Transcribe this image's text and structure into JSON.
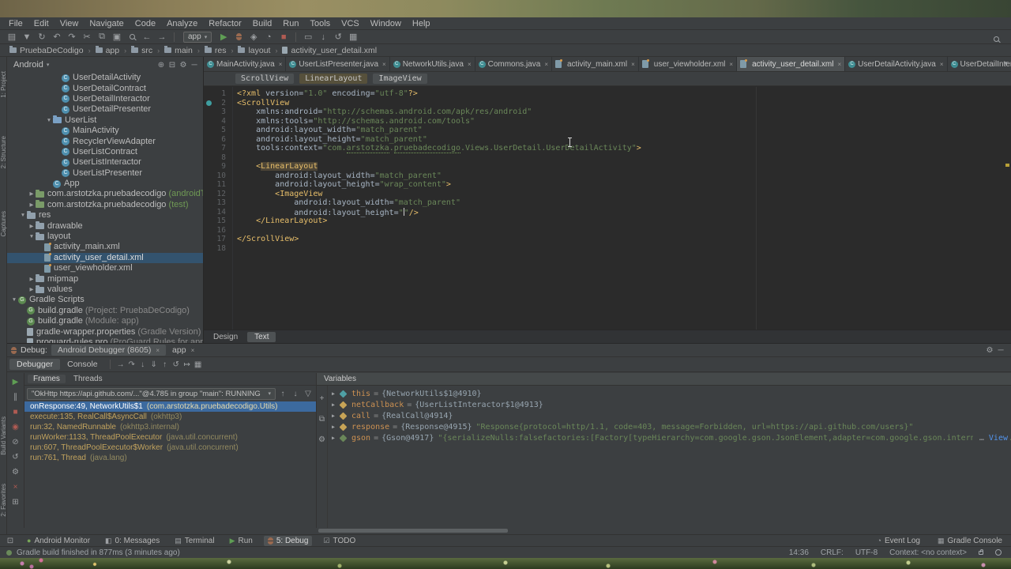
{
  "menubar": {
    "items": [
      "File",
      "Edit",
      "View",
      "Navigate",
      "Code",
      "Analyze",
      "Refactor",
      "Build",
      "Run",
      "Tools",
      "VCS",
      "Window",
      "Help"
    ]
  },
  "toolbar": {
    "icons_a": [
      {
        "name": "open-icon",
        "glyph": "▤"
      },
      {
        "name": "save-all-icon",
        "glyph": "▼"
      },
      {
        "name": "sync-icon",
        "glyph": "↻"
      },
      {
        "name": "undo-icon",
        "glyph": "↶"
      },
      {
        "name": "redo-icon",
        "glyph": "↷"
      },
      {
        "name": "cut-icon",
        "glyph": "✂"
      },
      {
        "name": "copy-icon",
        "glyph": "⧉"
      },
      {
        "name": "paste-icon",
        "glyph": "▣"
      },
      {
        "name": "find-icon",
        "shape": "magnifier"
      },
      {
        "name": "back-icon",
        "glyph": "←"
      },
      {
        "name": "forward-icon",
        "glyph": "→"
      }
    ],
    "run_config": "app",
    "icons_b": [
      {
        "name": "run-icon",
        "glyph": "▶",
        "color": "#5f9e54"
      },
      {
        "name": "debug-icon",
        "shape": "bug"
      },
      {
        "name": "coverage-icon",
        "glyph": "◈"
      },
      {
        "name": "profiler-icon",
        "glyph": "◔"
      },
      {
        "name": "stop-icon",
        "glyph": "■",
        "color": "#b05b53"
      }
    ],
    "icons_c": [
      {
        "name": "avd-manager-icon",
        "glyph": "▭"
      },
      {
        "name": "sdk-manager-icon",
        "glyph": "↓"
      },
      {
        "name": "gradle-sync-icon",
        "glyph": "↺"
      },
      {
        "name": "project-structure-icon",
        "glyph": "▦"
      }
    ]
  },
  "navbar": {
    "items": [
      "PruebaDeCodigo",
      "app",
      "src",
      "main",
      "res",
      "layout",
      "activity_user_detail.xml"
    ]
  },
  "stripe": {
    "top": [
      "1: Project",
      "2: Structure",
      "Captures"
    ],
    "bottom": [
      "Build Variants",
      "2: Favorites"
    ]
  },
  "project": {
    "mode": "Android",
    "rows": [
      {
        "label": "UserDetailActivity",
        "icon": "class",
        "lvl": 5
      },
      {
        "label": "UserDetailContract",
        "icon": "class",
        "lvl": 5
      },
      {
        "label": "UserDetailInteractor",
        "icon": "class",
        "lvl": 5
      },
      {
        "label": "UserDetailPresenter",
        "icon": "class",
        "lvl": 5
      },
      {
        "label": "UserList",
        "icon": "folder",
        "color": "#7aa0c4",
        "arrow": "down",
        "lvl": 4
      },
      {
        "label": "MainActivity",
        "icon": "class",
        "lvl": 5
      },
      {
        "label": "RecyclerViewAdapter",
        "icon": "class",
        "lvl": 5
      },
      {
        "label": "UserListContract",
        "icon": "class",
        "lvl": 5
      },
      {
        "label": "UserListInteractor",
        "icon": "class",
        "lvl": 5
      },
      {
        "label": "UserListPresenter",
        "icon": "class",
        "lvl": 5
      },
      {
        "label": "App",
        "icon": "class",
        "lvl": 4
      },
      {
        "label": "com.arstotzka.pruebadecodigo",
        "suffix": " (androidTest)",
        "green": true,
        "icon": "folder",
        "color": "#7a9b68",
        "arrow": "right",
        "lvl": 2
      },
      {
        "label": "com.arstotzka.pruebadecodigo",
        "suffix": " (test)",
        "green": true,
        "icon": "folder",
        "color": "#7a9b68",
        "arrow": "right",
        "lvl": 2
      },
      {
        "label": "res",
        "icon": "folder",
        "arrow": "down",
        "lvl": 1
      },
      {
        "label": "drawable",
        "icon": "folder",
        "arrow": "right",
        "lvl": 2
      },
      {
        "label": "layout",
        "icon": "folder",
        "arrow": "down",
        "lvl": 2
      },
      {
        "label": "activity_main.xml",
        "icon": "xml",
        "lvl": 3
      },
      {
        "label": "activity_user_detail.xml",
        "icon": "xml",
        "lvl": 3,
        "selected": true
      },
      {
        "label": "user_viewholder.xml",
        "icon": "xml",
        "lvl": 3
      },
      {
        "label": "mipmap",
        "icon": "folder",
        "arrow": "right",
        "lvl": 2
      },
      {
        "label": "values",
        "icon": "folder",
        "arrow": "right",
        "lvl": 2
      },
      {
        "label": "Gradle Scripts",
        "icon": "gradle",
        "arrow": "down",
        "lvl": 0
      },
      {
        "label": "build.gradle",
        "suffix": " (Project: PruebaDeCodigo)",
        "icon": "gradle",
        "lvl": 1
      },
      {
        "label": "build.gradle",
        "suffix": " (Module: app)",
        "icon": "gradle",
        "lvl": 1
      },
      {
        "label": "gradle-wrapper.properties",
        "suffix": " (Gradle Version)",
        "icon": "file",
        "lvl": 1
      },
      {
        "label": "proguard-rules.pro",
        "suffix": " (ProGuard Rules for app)",
        "icon": "file",
        "lvl": 1
      }
    ]
  },
  "editor": {
    "tabs": [
      {
        "label": "MainActivity.java",
        "icon": "java"
      },
      {
        "label": "UserListPresenter.java",
        "icon": "java"
      },
      {
        "label": "NetworkUtils.java",
        "icon": "java"
      },
      {
        "label": "Commons.java",
        "icon": "java"
      },
      {
        "label": "activity_main.xml",
        "icon": "xml"
      },
      {
        "label": "user_viewholder.xml",
        "icon": "xml"
      },
      {
        "label": "activity_user_detail.xml",
        "icon": "xml",
        "active": true
      },
      {
        "label": "UserDetailActivity.java",
        "icon": "java"
      },
      {
        "label": "UserDetailInteractor.java",
        "icon": "java"
      }
    ],
    "crumbs": [
      {
        "label": "ScrollView"
      },
      {
        "label": "LinearLayout",
        "hl": true
      },
      {
        "label": "ImageView"
      }
    ],
    "lines": [
      {
        "t": [
          [
            "pi",
            "<?xml "
          ],
          [
            "attr",
            "version="
          ],
          [
            "val",
            "\"1.0\""
          ],
          [
            "attr",
            " encoding="
          ],
          [
            "val",
            "\"utf-8\""
          ],
          [
            "pi",
            "?>"
          ]
        ]
      },
      {
        "g": true,
        "t": [
          [
            "tag",
            "<ScrollView"
          ]
        ]
      },
      {
        "t": [
          [
            "plain",
            "    "
          ],
          [
            "attr",
            "xmlns:android="
          ],
          [
            "val",
            "\"http://schemas.android.com/apk/res/android\""
          ]
        ]
      },
      {
        "t": [
          [
            "plain",
            "    "
          ],
          [
            "attr",
            "xmlns:tools="
          ],
          [
            "val",
            "\"http://schemas.android.com/tools\""
          ]
        ]
      },
      {
        "t": [
          [
            "plain",
            "    "
          ],
          [
            "attr",
            "android:layout_width="
          ],
          [
            "val",
            "\"match_parent\""
          ]
        ]
      },
      {
        "t": [
          [
            "plain",
            "    "
          ],
          [
            "attr",
            "android:layout_height="
          ],
          [
            "val",
            "\"match_parent\""
          ]
        ]
      },
      {
        "t": [
          [
            "plain",
            "    "
          ],
          [
            "attr",
            "tools:context="
          ],
          [
            "val",
            "\"com."
          ],
          [
            "valu",
            "arstotzka"
          ],
          [
            "val",
            "."
          ],
          [
            "valu",
            "pruebadecodigo"
          ],
          [
            "val",
            ".Views.UserDetail.UserDetailActivity\""
          ],
          [
            "tag",
            ">"
          ]
        ]
      },
      {
        "t": []
      },
      {
        "t": [
          [
            "plain",
            "    "
          ],
          [
            "tag",
            "<"
          ],
          [
            "taghl",
            "LinearLayout"
          ]
        ]
      },
      {
        "t": [
          [
            "plain",
            "        "
          ],
          [
            "attr",
            "android:layout_width="
          ],
          [
            "val",
            "\"match_parent\""
          ]
        ]
      },
      {
        "t": [
          [
            "plain",
            "        "
          ],
          [
            "attr",
            "android:layout_height="
          ],
          [
            "val",
            "\"wrap_content\""
          ],
          [
            "tag",
            ">"
          ]
        ]
      },
      {
        "t": [
          [
            "plain",
            "        "
          ],
          [
            "tag",
            "<ImageView"
          ]
        ]
      },
      {
        "t": [
          [
            "plain",
            "            "
          ],
          [
            "attr",
            "android:layout_width="
          ],
          [
            "val",
            "\"match_parent\""
          ]
        ]
      },
      {
        "t": [
          [
            "plain",
            "            "
          ],
          [
            "attr",
            "android:layout_height="
          ],
          [
            "val",
            "\""
          ],
          [
            "cursor",
            ""
          ],
          [
            "val",
            "\""
          ],
          [
            "tag",
            "/>"
          ]
        ]
      },
      {
        "t": [
          [
            "plain",
            "    "
          ],
          [
            "tag",
            "</LinearLayout>"
          ]
        ]
      },
      {
        "t": []
      },
      {
        "t": [
          [
            "tag",
            "</ScrollView>"
          ]
        ]
      },
      {
        "t": []
      }
    ],
    "bottom_tabs": [
      {
        "label": "Design"
      },
      {
        "label": "Text",
        "active": true
      }
    ]
  },
  "debug": {
    "title": "Debug:",
    "session_tabs": [
      {
        "label": "Android Debugger (8605)",
        "active": true
      },
      {
        "label": "app"
      }
    ],
    "view_tabs": [
      {
        "label": "Debugger",
        "active": true
      },
      {
        "label": "Console"
      }
    ],
    "step_icons": [
      {
        "name": "show-execution-point-icon",
        "glyph": "→"
      },
      {
        "name": "step-over-icon",
        "glyph": "↷"
      },
      {
        "name": "step-into-icon",
        "glyph": "↓"
      },
      {
        "name": "force-step-into-icon",
        "glyph": "⇓"
      },
      {
        "name": "step-out-icon",
        "glyph": "↑"
      },
      {
        "name": "drop-frame-icon",
        "glyph": "↺"
      },
      {
        "name": "run-to-cursor-icon",
        "glyph": "↦"
      },
      {
        "name": "evaluate-expression-icon",
        "glyph": "▦"
      }
    ],
    "left_icons": [
      {
        "name": "resume-icon",
        "glyph": "▶",
        "color": "#5f9e54"
      },
      {
        "name": "pause-icon",
        "glyph": "∥"
      },
      {
        "name": "stop-icon",
        "glyph": "■",
        "color": "#b05b53"
      },
      {
        "name": "view-breakpoints-icon",
        "glyph": "◉",
        "color": "#b05b53"
      },
      {
        "name": "mute-breakpoints-icon",
        "glyph": "⊘"
      },
      {
        "name": "restore-layout-icon",
        "glyph": "↺"
      },
      {
        "name": "debug-settings-icon",
        "glyph": "⚙"
      },
      {
        "name": "close-session-icon",
        "glyph": "×",
        "color": "#b05b53"
      },
      {
        "name": "pin-icon",
        "glyph": "⊞"
      }
    ],
    "frames_tabs": [
      {
        "label": "Frames",
        "active": true
      },
      {
        "label": "Threads"
      }
    ],
    "thread_combo": "\"OkHttp https://api.github.com/...\"@4.785 in group \"main\": RUNNING",
    "frames": [
      {
        "main": "onResponse:49, NetworkUtils$1",
        "pkg": "(com.arstotzka.pruebadecodigo.Utils)",
        "selected": true
      },
      {
        "main": "execute:135, RealCall$AsyncCall",
        "pkg": "(okhttp3)"
      },
      {
        "main": "run:32, NamedRunnable",
        "pkg": "(okhttp3.internal)"
      },
      {
        "main": "runWorker:1133, ThreadPoolExecutor",
        "pkg": "(java.util.concurrent)"
      },
      {
        "main": "run:607, ThreadPoolExecutor$Worker",
        "pkg": "(java.util.concurrent)"
      },
      {
        "main": "run:761, Thread",
        "pkg": "(java.lang)"
      }
    ],
    "variables_title": "Variables",
    "variables": [
      {
        "name": "this",
        "ref": "{NetworkUtils$1@4910}",
        "icon": "#4fa0a5"
      },
      {
        "name": "netCallback",
        "ref": "{UserListInteractor$1@4913}",
        "icon": "#c7a456"
      },
      {
        "name": "call",
        "ref": "{RealCall@4914}",
        "icon": "#c7a456"
      },
      {
        "name": "response",
        "ref": "{Response@4915}",
        "str": "\"Response{protocol=http/1.1, code=403, message=Forbidden, url=https://api.github.com/users}\"",
        "icon": "#c7a456"
      },
      {
        "name": "gson",
        "ref": "{Gson@4917}",
        "str": "\"{serializeNulls:falsefactories:[Factory[typeHierarchy=com.google.gson.JsonElement,adapter=com.google.gson.internal.bind.TypeAdapters$29@123e5df], com.google.gson.internal.bind.ObjectTypeAdapter",
        "icon": "#6a8759",
        "link": "View"
      }
    ]
  },
  "toolwindow_bar": {
    "left": [
      {
        "label": "Android Monitor",
        "icon": "android"
      },
      {
        "label": "0: Messages",
        "icon": "messages"
      },
      {
        "label": "Terminal",
        "icon": "terminal"
      },
      {
        "label": "Run",
        "icon": "run"
      },
      {
        "label": "5: Debug",
        "icon": "debug",
        "active": true
      },
      {
        "label": "TODO",
        "icon": "todo"
      }
    ],
    "right": [
      {
        "label": "Event Log",
        "icon": "event-log"
      },
      {
        "label": "Gradle Console",
        "icon": "gradle-console"
      }
    ]
  },
  "status": {
    "message": "Gradle build finished in 877ms (3 minutes ago)",
    "segments": [
      "14:36",
      "CRLF:",
      "UTF-8",
      "Context: <no context>"
    ]
  }
}
